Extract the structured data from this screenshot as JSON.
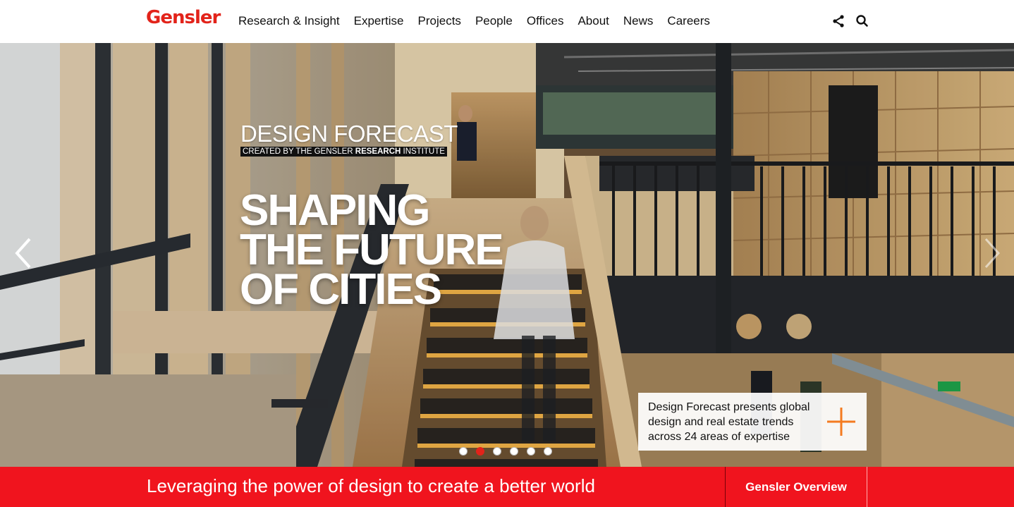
{
  "header": {
    "logo": "Gensler",
    "nav": [
      {
        "label": "Research & Insight"
      },
      {
        "label": "Expertise"
      },
      {
        "label": "Projects"
      },
      {
        "label": "People"
      },
      {
        "label": "Offices"
      },
      {
        "label": "About"
      },
      {
        "label": "News"
      },
      {
        "label": "Careers"
      }
    ],
    "icons": {
      "share": "share-icon",
      "search": "search-icon"
    }
  },
  "hero": {
    "kicker": "DESIGN FORECAST",
    "subtitle_pre": "CREATED BY THE GENSLER ",
    "subtitle_bold": "RESEARCH",
    "subtitle_post": " INSTITUTE",
    "headline": [
      "SHAPING",
      "THE FUTURE",
      "OF CITIES"
    ],
    "promo": {
      "text": "Design Forecast presents global design and real estate trends across 24 areas of expertise",
      "icon": "plus-icon",
      "accent": "#f47b20"
    },
    "slides": 6,
    "active_slide": 2
  },
  "footer_bar": {
    "tagline": "Leveraging the power of design to create a better world",
    "button": "Gensler Overview",
    "color": "#f0141e"
  },
  "colors": {
    "brand": "#e2231a"
  }
}
